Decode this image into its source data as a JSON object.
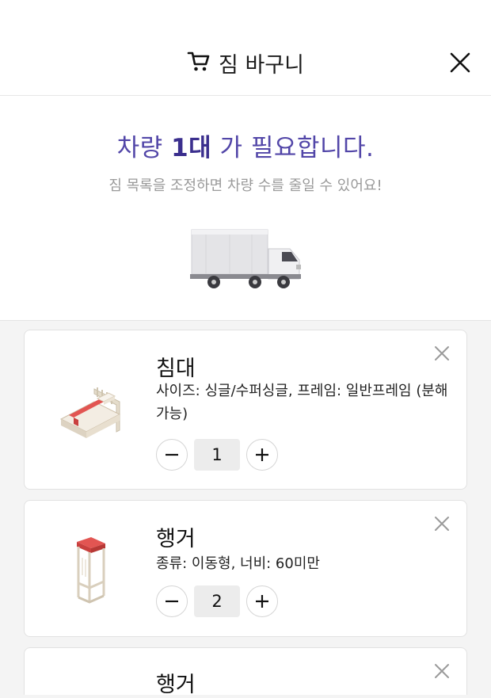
{
  "header": {
    "title": "짐 바구니"
  },
  "summary": {
    "headline_prefix": "차량 ",
    "vehicle_count": "1대",
    "headline_suffix": " 가 필요합니다.",
    "subline": "짐 목록을 조정하면 차량 수를 줄일 수 있어요!"
  },
  "items": [
    {
      "name": "침대",
      "desc": "사이즈: 싱글/수퍼싱글, 프레임: 일반프레임 (분해가능)",
      "quantity": "1",
      "icon": "bed-icon"
    },
    {
      "name": "행거",
      "desc": "종류: 이동형, 너비: 60미만",
      "quantity": "2",
      "icon": "hanger-rack-icon"
    },
    {
      "name": "행거",
      "desc": "",
      "quantity": "",
      "icon": "hanger-rack-icon"
    }
  ]
}
